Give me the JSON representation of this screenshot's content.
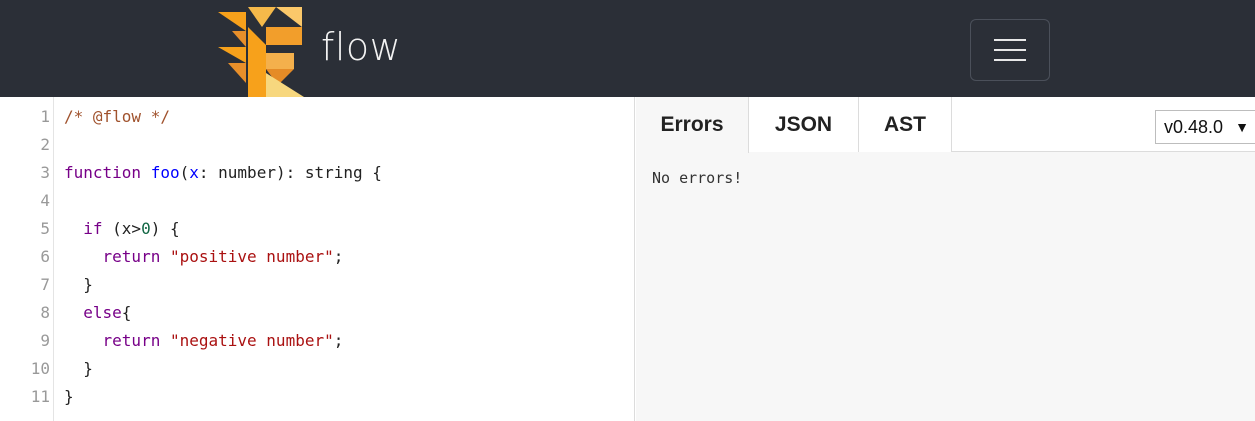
{
  "header": {
    "brand": "flow",
    "menu_icon": "hamburger-menu-icon",
    "colors": {
      "background": "#2b2f37",
      "logo_orange": "#f7a11b",
      "logo_amber": "#e88f2a"
    }
  },
  "editor": {
    "lines": [
      {
        "num": "1",
        "tokens": [
          {
            "t": "/* @flow */",
            "k": "comment"
          }
        ]
      },
      {
        "num": "2",
        "tokens": []
      },
      {
        "num": "3",
        "tokens": [
          {
            "t": "function",
            "k": "kw"
          },
          {
            "t": " ",
            "k": "var"
          },
          {
            "t": "foo",
            "k": "def"
          },
          {
            "t": "(",
            "k": "var"
          },
          {
            "t": "x",
            "k": "def"
          },
          {
            "t": ": number): string {",
            "k": "var"
          }
        ]
      },
      {
        "num": "4",
        "tokens": []
      },
      {
        "num": "5",
        "tokens": [
          {
            "t": "  ",
            "k": "var"
          },
          {
            "t": "if",
            "k": "kw"
          },
          {
            "t": " (x>",
            "k": "var"
          },
          {
            "t": "0",
            "k": "num"
          },
          {
            "t": ") {",
            "k": "var"
          }
        ]
      },
      {
        "num": "6",
        "tokens": [
          {
            "t": "    ",
            "k": "var"
          },
          {
            "t": "return",
            "k": "kw"
          },
          {
            "t": " ",
            "k": "var"
          },
          {
            "t": "\"positive number\"",
            "k": "str"
          },
          {
            "t": ";",
            "k": "var"
          }
        ]
      },
      {
        "num": "7",
        "tokens": [
          {
            "t": "  }",
            "k": "var"
          }
        ]
      },
      {
        "num": "8",
        "tokens": [
          {
            "t": "  ",
            "k": "var"
          },
          {
            "t": "else",
            "k": "kw"
          },
          {
            "t": "{",
            "k": "var"
          }
        ]
      },
      {
        "num": "9",
        "tokens": [
          {
            "t": "    ",
            "k": "var"
          },
          {
            "t": "return",
            "k": "kw"
          },
          {
            "t": " ",
            "k": "var"
          },
          {
            "t": "\"negative number\"",
            "k": "str"
          },
          {
            "t": ";",
            "k": "var"
          }
        ]
      },
      {
        "num": "10",
        "tokens": [
          {
            "t": "  }",
            "k": "var"
          }
        ]
      },
      {
        "num": "11",
        "tokens": [
          {
            "t": "}",
            "k": "var"
          }
        ]
      }
    ]
  },
  "output": {
    "tabs": [
      "Errors",
      "JSON",
      "AST"
    ],
    "active_tab": "Errors",
    "version": {
      "selected": "v0.48.0",
      "arrow": "▼"
    },
    "status_text": "No errors!"
  }
}
